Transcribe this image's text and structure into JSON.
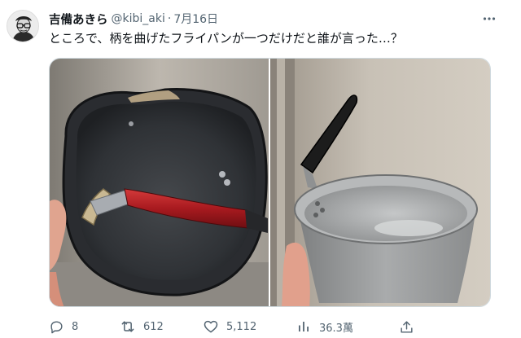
{
  "tweet": {
    "display_name": "吉備あきら",
    "handle": "@kibi_aki",
    "separator": "·",
    "date": "7月16日",
    "text": "ところで、柄を曲げたフライパンが一つだけだと誰が言った…？",
    "more_icon": "ellipsis-icon"
  },
  "media": {
    "photos": [
      {
        "subject": "frying-pan-with-bent-red-handle"
      },
      {
        "subject": "aluminum-pot-with-bent-black-handle"
      }
    ]
  },
  "actions": {
    "reply": {
      "icon": "reply-icon",
      "count": "8"
    },
    "retweet": {
      "icon": "retweet-icon",
      "count": "612"
    },
    "like": {
      "icon": "heart-icon",
      "count": "5,112"
    },
    "views": {
      "icon": "views-chart-icon",
      "count": "36.3萬"
    },
    "share": {
      "icon": "share-icon"
    }
  },
  "colors": {
    "text_primary": "#0f1419",
    "text_secondary": "#536471",
    "border": "#cfd9de",
    "pan_handle_red": "#b01e23",
    "pot_handle_black": "#1c1c1c"
  }
}
